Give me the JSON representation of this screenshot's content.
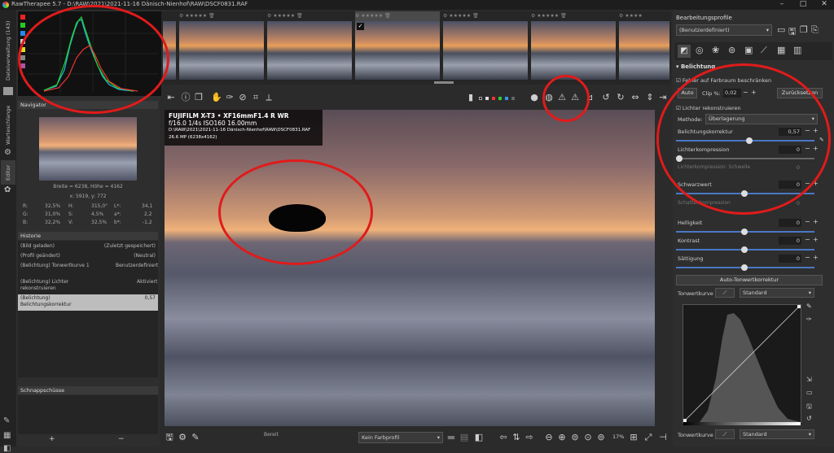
{
  "titlebar": {
    "title": "RawTherapee 5.7 - D:\\RAW\\2021\\2021-11-16 Dänisch-Nienhof\\RAW\\DSCF0831.RAF",
    "minimize": "–",
    "maximize": "□",
    "close": "✕"
  },
  "vtabs": {
    "dateiverwaltung": "Dateiverwaltung (143)",
    "warteschlange": "Warteschlange",
    "editor": "Editor"
  },
  "navigator": {
    "header": "Navigator",
    "size": "Breite = 6238, Höhe = 4162",
    "pos": "x: 5919, y: 772",
    "r_label": "R:",
    "r_val": "32,5%",
    "g_label": "G:",
    "g_val": "31,0%",
    "b_label": "B:",
    "b_val": "32,2%",
    "h_label": "H:",
    "h_val": "315,0°",
    "s_label": "S:",
    "s_val": "4,5%",
    "v_label": "V:",
    "v_val": "32,5%",
    "l_label": "L*:",
    "l_val": "34,1",
    "a_label": "a*:",
    "a_val": "2,2",
    "bb_label": "b*:",
    "bb_val": "-1,2"
  },
  "history": {
    "header": "Historie",
    "items": [
      {
        "a": "(Bild geladen)",
        "b": "(Zuletzt gespeichert)"
      },
      {
        "a": "(Profil geändert)",
        "b": "(Neutral)"
      },
      {
        "a": "(Belichtung) Tonwertkurve 1",
        "b": "Benutzerdefiniert"
      },
      {
        "a": "(Belichtung) Lichter rekonstruieren",
        "b": "Aktiviert"
      },
      {
        "a": "(Belichtung) Belichtungskorrektur",
        "b": "0,57"
      }
    ]
  },
  "snapshots": {
    "header": "Schnappschüsse",
    "add": "+",
    "remove": "−"
  },
  "exif": {
    "camera": "FUJIFILM X-T3 • XF16mmF1.4 R WR",
    "settings": "f/16.0  1/4s  ISO160  16.00mm",
    "path": "D:\\RAW\\2021\\2021-11-16 Dänisch-Nienhof\\RAW\\DSCF0831.RAF",
    "mp": "26.6 MP (6238x4162)"
  },
  "bottombar": {
    "status": "Bereit",
    "profile": "Kein Farbprofil",
    "zoom": "17%"
  },
  "right": {
    "header": "Bearbeitungsprofile",
    "profile": "(Benutzerdefiniert)",
    "section": "Belichtung",
    "clip_check": "Fehler auf Farbraum beschränken",
    "auto": "Auto",
    "clip_label": "Clip %:",
    "clip_val": "0,02",
    "reset": "Zurücksetzen",
    "lichter_check": "Lichter rekonstruieren",
    "methode_label": "Methode:",
    "methode_val": "Überlagerung",
    "belichtung_label": "Belichtungskorrektur",
    "belichtung_val": "0,57",
    "lichterkomp_label": "Lichterkompression",
    "lichterkomp_val": "0",
    "lichterkomp_sw_label": "Lichterkompression: Schwelle",
    "lichterkomp_sw_val": "0",
    "schwarz_label": "Schwarzwert",
    "schwarz_val": "0",
    "schatten_label": "Schattenkompression",
    "schatten_val": "0",
    "helligkeit_label": "Helligkeit",
    "helligkeit_val": "0",
    "kontrast_label": "Kontrast",
    "kontrast_val": "0",
    "saettigung_label": "Sättigung",
    "saettigung_val": "0",
    "auto_tonwert": "Auto-Tonwertkorrektur",
    "tonwert1_label": "Tonwertkurve 1:",
    "tonwert1_val": "Standard",
    "tonwert2_label": "Tonwertkurve 2:",
    "tonwert2_val": "Standard"
  },
  "colors": {
    "accent": "#4a78c4",
    "annotation": "#e01b1b"
  }
}
